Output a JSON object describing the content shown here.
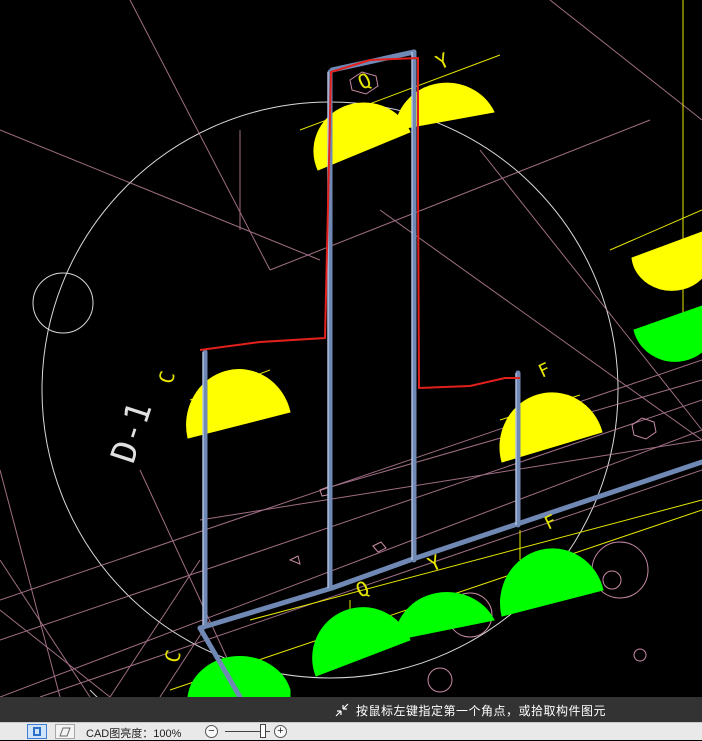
{
  "status": {
    "prompt": "按鼠标左键指定第一个角点，或拾取构件图元",
    "cad_brightness_label": "CAD图亮度：100%"
  },
  "drawing": {
    "axis_labels": {
      "q_top": "Q",
      "y_top": "Y",
      "c_left": "C",
      "f_right": "F",
      "q_bottom": "Q",
      "y_bottom": "Y",
      "f_bottom": "F",
      "c_bottom": "C"
    },
    "section_label": "D-1",
    "colors": {
      "background": "#000000",
      "pipe": "#6f88b4",
      "selection_outline": "#e3201b",
      "upper_fitting": "#ffff00",
      "lower_fitting": "#00ff00",
      "axis_line": "#d8a0b8",
      "aux_line": "#ffff00"
    }
  },
  "toolbar": {
    "icons": [
      "select-mode-icon",
      "layer-icon",
      "zoom-out-icon",
      "zoom-in-icon"
    ],
    "zoom_out_glyph": "−",
    "zoom_in_glyph": "+"
  }
}
